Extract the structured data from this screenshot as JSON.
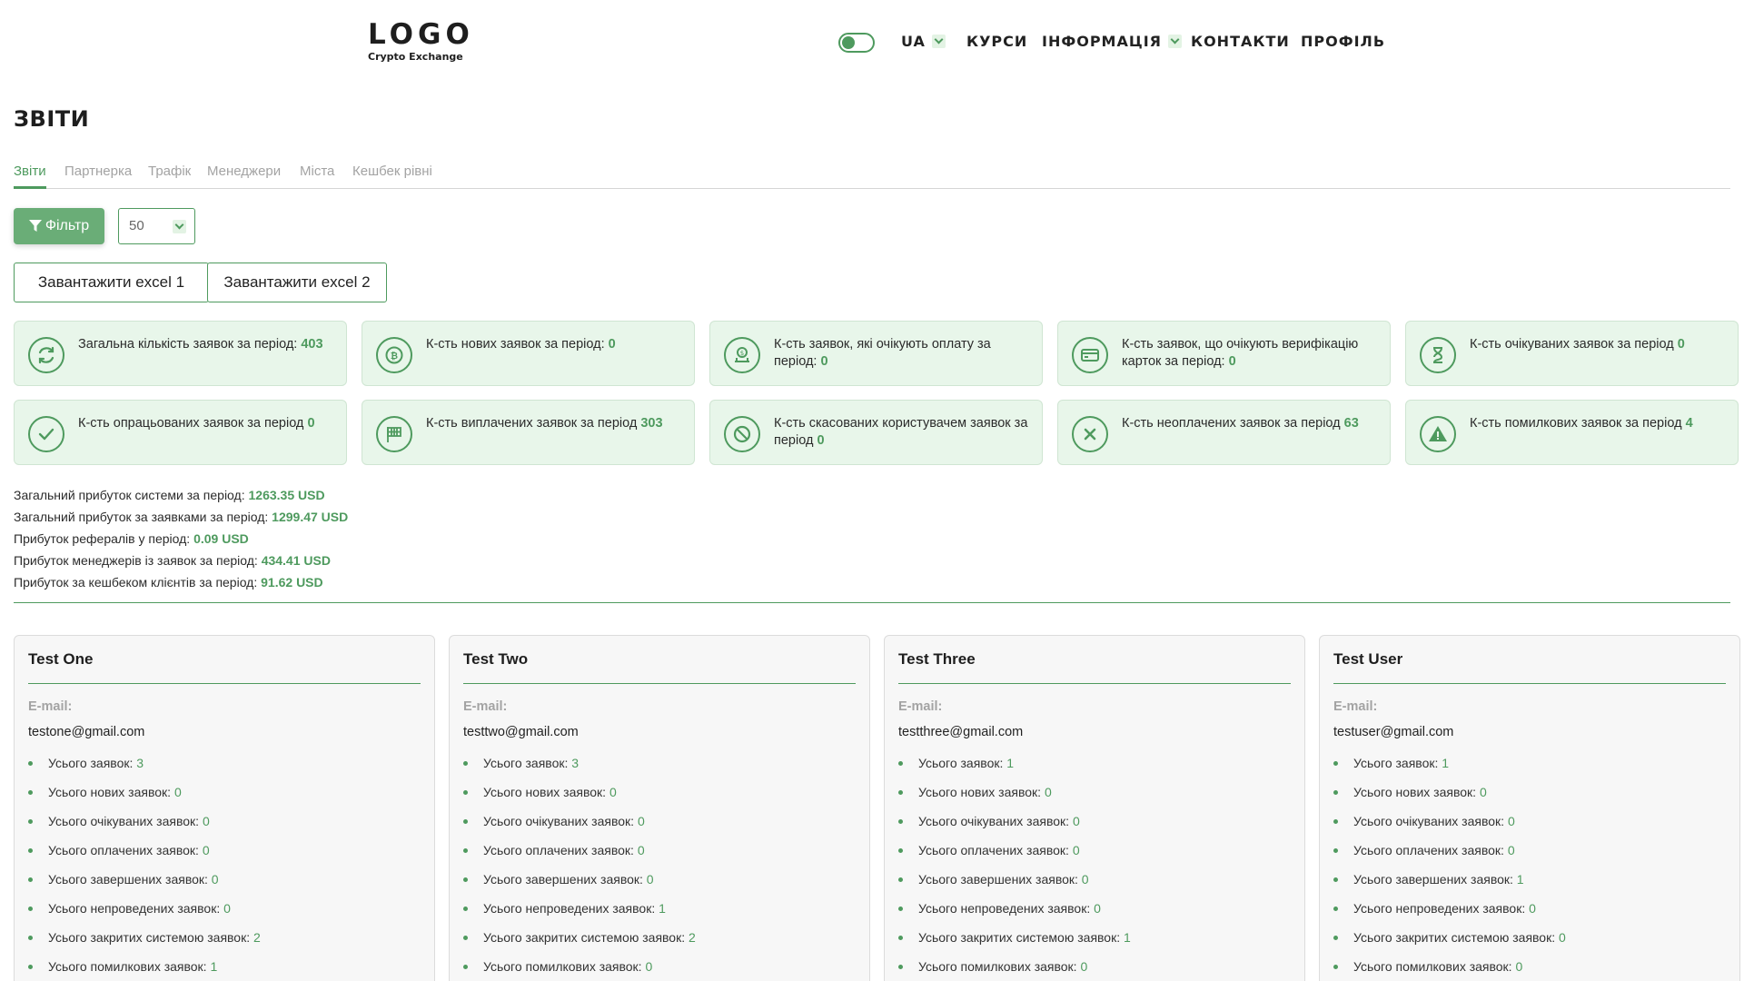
{
  "header": {
    "logo_title": "LOGO",
    "logo_subtitle": "Crypto Exchange",
    "lang": "UA",
    "nav": [
      "КУРСИ",
      "ІНФОРМАЦІЯ",
      "КОНТАКТИ",
      "ПРОФІЛЬ"
    ]
  },
  "page_title": "ЗВІТИ",
  "tabs": [
    "Звіти",
    "Партнерка",
    "Трафік",
    "Менеджери",
    "Міста",
    "Кешбек рівні"
  ],
  "filter": {
    "label": "Фільтр",
    "per_page": "50"
  },
  "excel": [
    "Завантажити excel 1",
    "Завантажити excel 2"
  ],
  "stats": [
    {
      "label": "Загальна кількість заявок за період:",
      "value": "403",
      "icon": "refresh-icon"
    },
    {
      "label": "К-сть нових заявок за період:",
      "value": "0",
      "icon": "bitcoin-icon"
    },
    {
      "label": "К-сть заявок, які очікують оплату за період:",
      "value": "0",
      "icon": "money-hand-icon"
    },
    {
      "label": "К-сть заявок, що очікують верифікацію карток за період:",
      "value": "0",
      "icon": "card-icon"
    },
    {
      "label": "К-сть очікуваних заявок за період",
      "value": "0",
      "icon": "hourglass-icon"
    },
    {
      "label": "К-сть опрацьованих заявок за період",
      "value": "0",
      "icon": "check-icon"
    },
    {
      "label": "К-сть виплачених заявок за період",
      "value": "303",
      "icon": "flag-icon"
    },
    {
      "label": "К-сть скасованих користувачем заявок за період",
      "value": "0",
      "icon": "ban-icon"
    },
    {
      "label": "К-сть неоплачених заявок за період",
      "value": "63",
      "icon": "close-icon"
    },
    {
      "label": "К-сть помилкових заявок за період",
      "value": "4",
      "icon": "warning-icon"
    }
  ],
  "profits": [
    {
      "label": "Загальний прибуток системи за період:",
      "value": "1263.35 USD"
    },
    {
      "label": "Загальний прибуток за заявками за період:",
      "value": "1299.47 USD"
    },
    {
      "label": "Прибуток рефералів у період:",
      "value": "0.09 USD"
    },
    {
      "label": "Прибуток менеджерів із заявок за період:",
      "value": "434.41 USD"
    },
    {
      "label": "Прибуток за кешбеком клієнтів за період:",
      "value": "91.62 USD"
    }
  ],
  "email_label": "E-mail:",
  "stat_labels": [
    "Усього заявок:",
    "Усього нових заявок:",
    "Усього очікуваних заявок:",
    "Усього оплачених заявок:",
    "Усього завершених заявок:",
    "Усього непроведених заявок:",
    "Усього закритих системою заявок:",
    "Усього помилкових заявок:"
  ],
  "managers": [
    {
      "name": "Test One",
      "email": "testone@gmail.com",
      "values": [
        "3",
        "0",
        "0",
        "0",
        "0",
        "0",
        "2",
        "1"
      ]
    },
    {
      "name": "Test Two",
      "email": "testtwo@gmail.com",
      "values": [
        "3",
        "0",
        "0",
        "0",
        "0",
        "1",
        "2",
        "0"
      ]
    },
    {
      "name": "Test Three",
      "email": "testthree@gmail.com",
      "values": [
        "1",
        "0",
        "0",
        "0",
        "0",
        "0",
        "1",
        "0"
      ]
    },
    {
      "name": "Test User",
      "email": "testuser@gmail.com",
      "values": [
        "1",
        "0",
        "0",
        "0",
        "1",
        "0",
        "0",
        "0"
      ]
    }
  ],
  "colors": {
    "accent": "#4e9a5e",
    "card_bg": "#e8f6ea",
    "muted": "#a3a3a3"
  }
}
